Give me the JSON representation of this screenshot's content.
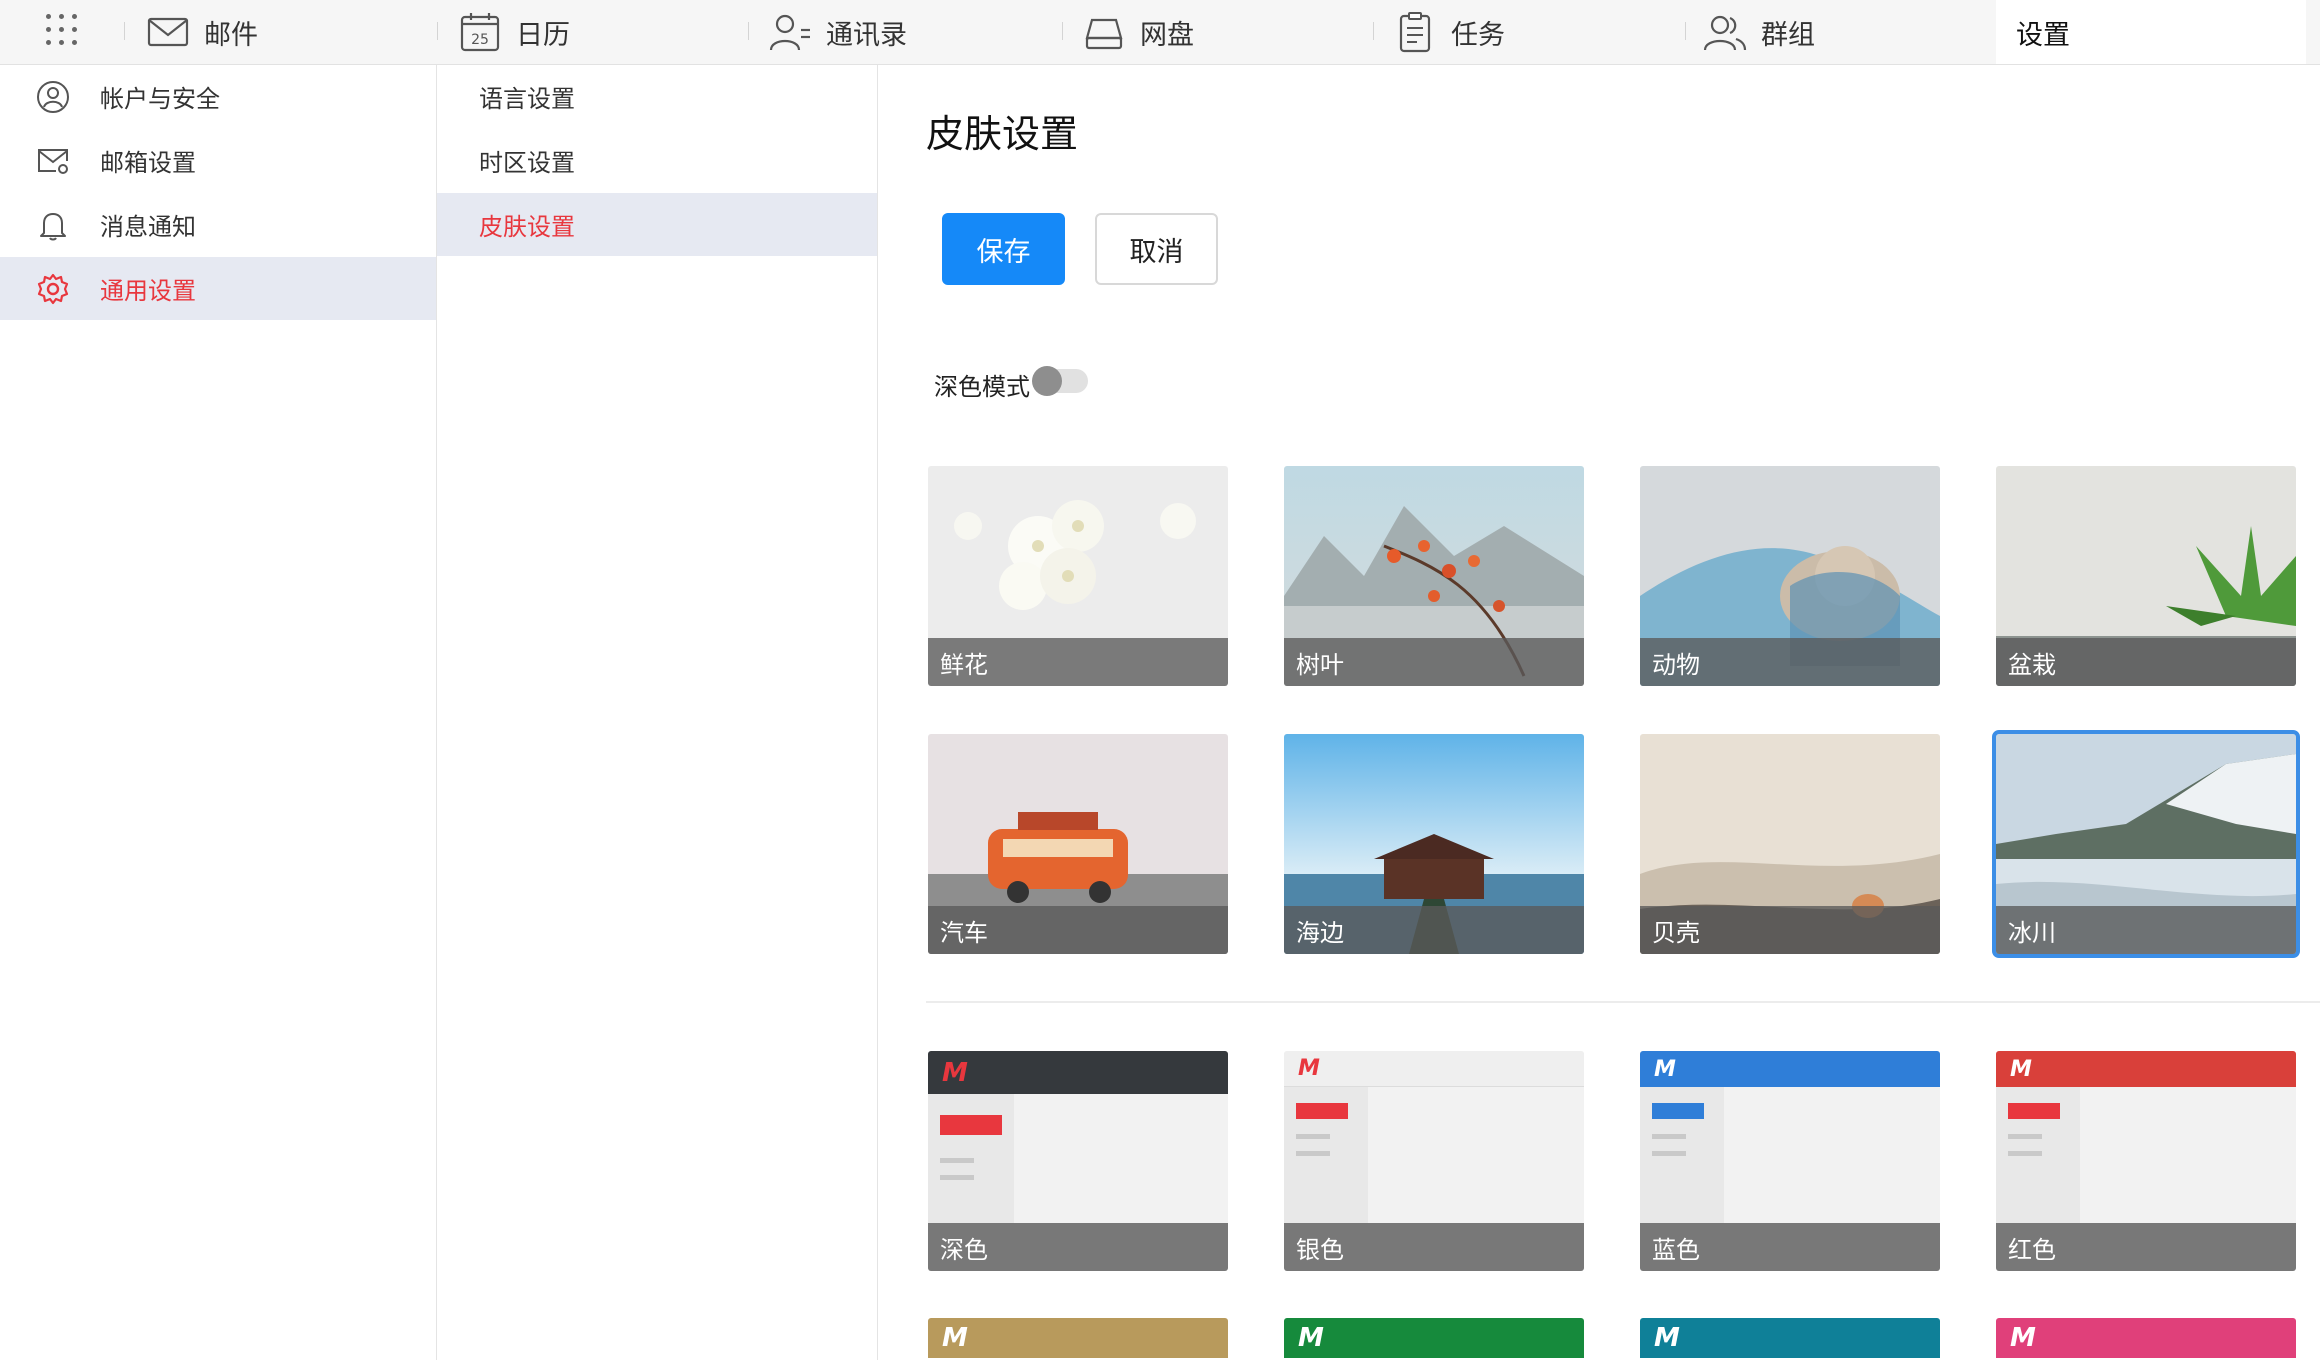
{
  "nav": {
    "items": [
      {
        "label": "邮件",
        "icon": "mail-icon"
      },
      {
        "label": "日历",
        "icon": "calendar-icon",
        "badge": "25"
      },
      {
        "label": "通讯录",
        "icon": "contacts-icon"
      },
      {
        "label": "网盘",
        "icon": "drive-icon"
      },
      {
        "label": "任务",
        "icon": "task-icon"
      },
      {
        "label": "群组",
        "icon": "group-icon"
      }
    ],
    "active": "设置"
  },
  "sidebar": {
    "items": [
      {
        "label": "帐户与安全",
        "icon": "user-circle-icon"
      },
      {
        "label": "邮箱设置",
        "icon": "mail-settings-icon"
      },
      {
        "label": "消息通知",
        "icon": "bell-icon"
      },
      {
        "label": "通用设置",
        "icon": "gear-icon",
        "active": true
      }
    ]
  },
  "submenu": {
    "items": [
      {
        "label": "语言设置"
      },
      {
        "label": "时区设置"
      },
      {
        "label": "皮肤设置",
        "active": true
      }
    ]
  },
  "main": {
    "title": "皮肤设置",
    "save_label": "保存",
    "cancel_label": "取消",
    "dark_mode_label": "深色模式",
    "dark_mode_on": false,
    "wallpapers": [
      {
        "label": "鲜花"
      },
      {
        "label": "树叶"
      },
      {
        "label": "动物"
      },
      {
        "label": "盆栽"
      },
      {
        "label": "汽车"
      },
      {
        "label": "海边"
      },
      {
        "label": "贝壳"
      },
      {
        "label": "冰川",
        "selected": true
      }
    ],
    "themes": [
      {
        "label": "深色",
        "header_color": "#35393d",
        "logo_color": "#e8373e",
        "pill_color": "#e8373e"
      },
      {
        "label": "银色",
        "header_color": "#efefef",
        "logo_color": "#e8373e",
        "pill_color": "#e8373e"
      },
      {
        "label": "蓝色",
        "header_color": "#2f7ed8",
        "logo_color": "#ffffff",
        "pill_color": "#2f7ed8"
      },
      {
        "label": "红色",
        "header_color": "#d9403a",
        "logo_color": "#ffffff",
        "pill_color": "#e8373e"
      }
    ],
    "more_themes": [
      {
        "header_color": "#b89a5c"
      },
      {
        "header_color": "#168a3c"
      },
      {
        "header_color": "#0f8098"
      },
      {
        "header_color": "#e0407a"
      }
    ],
    "logo_letter": "M"
  },
  "colors": {
    "accent": "#1589f8",
    "active_text": "#e8373e",
    "active_bg": "#e6e9f2"
  }
}
